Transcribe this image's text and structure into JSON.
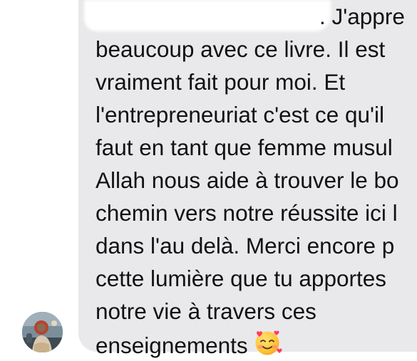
{
  "message": {
    "lines": [
      ". J'appre",
      "beaucoup avec ce livre. Il est",
      "vraiment fait pour moi. Et",
      "l'entrepreneuriat c'est ce qu'il",
      "faut en tant que femme musul",
      "Allah nous aide à trouver le bo",
      "chemin vers notre réussite ici l",
      "dans l'au delà. Merci encore p",
      "cette lumière que tu apportes",
      "notre vie à travers ces",
      "enseignements"
    ],
    "emoji": "smiling-face-with-hearts-icon"
  },
  "sender": {
    "avatar": "avatar"
  },
  "colors": {
    "bubble": "#e9e9eb",
    "text": "#111111",
    "background": "#ffffff"
  }
}
